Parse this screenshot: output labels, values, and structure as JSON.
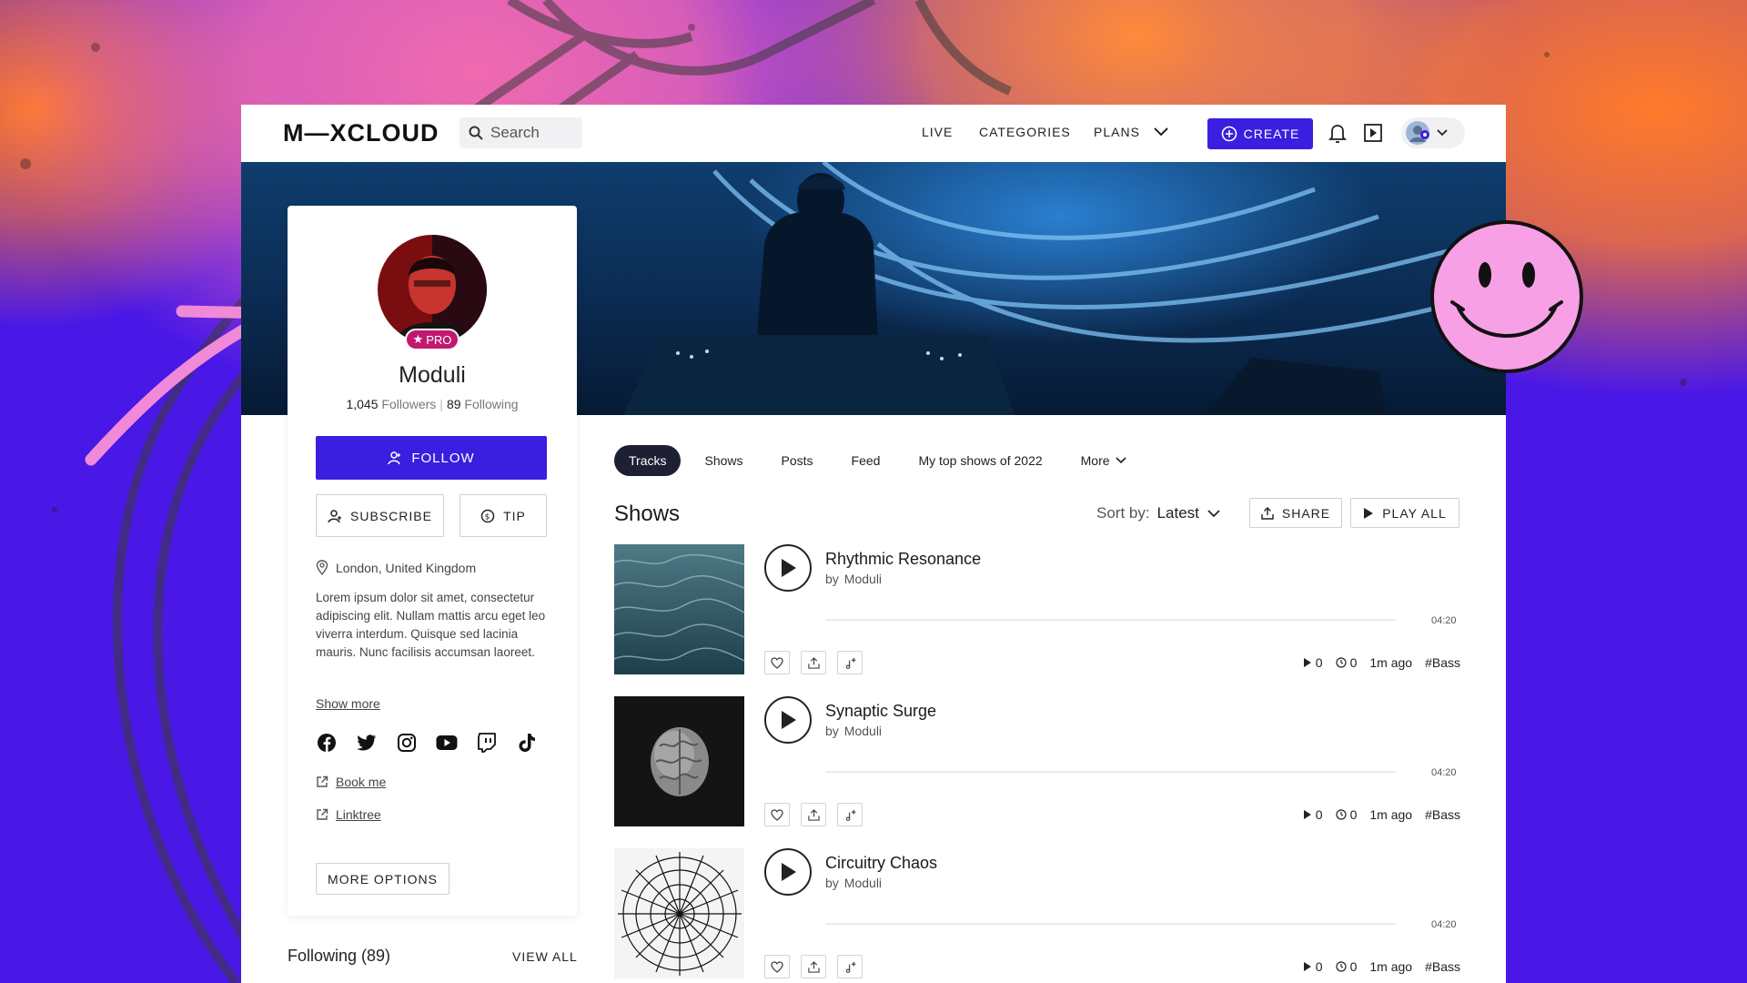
{
  "header": {
    "logo": "M—XCLOUD",
    "search_placeholder": "Search",
    "nav": {
      "live": "LIVE",
      "categories": "CATEGORIES",
      "plans": "PLANS"
    },
    "create_label": "CREATE"
  },
  "profile": {
    "pro_label": "PRO",
    "name": "Moduli",
    "followers_count": "1,045",
    "followers_label": "Followers",
    "following_count": "89",
    "following_label": "Following",
    "follow_label": "FOLLOW",
    "subscribe_label": "SUBSCRIBE",
    "tip_label": "TIP",
    "location": "London, United Kingdom",
    "bio": "Lorem ipsum dolor sit amet, consectetur adipiscing elit. Nullam mattis arcu eget leo viverra interdum. Quisque sed lacinia mauris. Nunc facilisis accumsan laoreet. Duis",
    "show_more": "Show more",
    "socials": [
      "facebook-icon",
      "twitter-icon",
      "instagram-icon",
      "youtube-icon",
      "twitch-icon",
      "tiktok-icon"
    ],
    "links": [
      "Book me",
      "Linktree"
    ],
    "more_options_label": "MORE OPTIONS",
    "following_heading": "Following (89)",
    "view_all_label": "VIEW ALL"
  },
  "tabs": [
    "Tracks",
    "Shows",
    "Posts",
    "Feed",
    "My top shows of 2022",
    "More"
  ],
  "active_tab": "Tracks",
  "shows": {
    "title": "Shows",
    "sort_label": "Sort by:",
    "sort_value": "Latest",
    "share_label": "SHARE",
    "play_all_label": "PLAY ALL",
    "items": [
      {
        "title": "Rhythmic Resonance",
        "by_prefix": "by",
        "artist": "Moduli",
        "duration": "04:20",
        "plays": "0",
        "listen_time": "0",
        "age": "1m ago",
        "tag": "#Bass"
      },
      {
        "title": "Synaptic Surge",
        "by_prefix": "by",
        "artist": "Moduli",
        "duration": "04:20",
        "plays": "0",
        "listen_time": "0",
        "age": "1m ago",
        "tag": "#Bass"
      },
      {
        "title": "Circuitry Chaos",
        "by_prefix": "by",
        "artist": "Moduli",
        "duration": "04:20",
        "plays": "0",
        "listen_time": "0",
        "age": "1m ago",
        "tag": "#Bass"
      }
    ]
  },
  "colors": {
    "accent": "#3a1fe0",
    "pro_badge": "#c2186f",
    "active_tab": "#1d1f33",
    "background": "#4a18e6",
    "smiley": "#f7a0e6"
  }
}
